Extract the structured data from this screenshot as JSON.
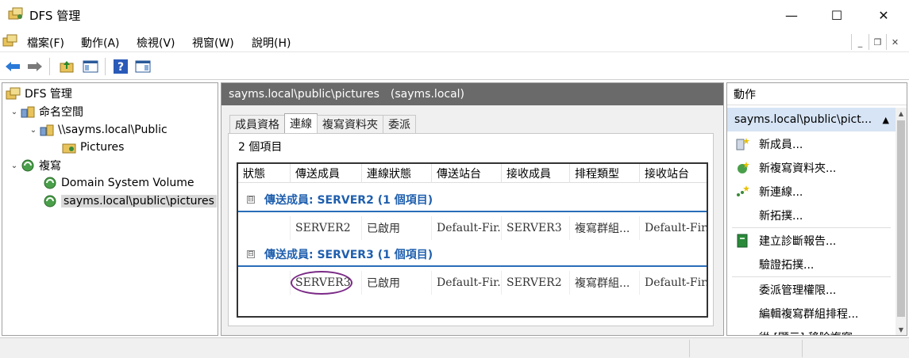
{
  "window": {
    "title": "DFS 管理",
    "minimize_glyph": "—",
    "maximize_glyph": "☐",
    "close_glyph": "✕"
  },
  "menu": {
    "items": [
      "檔案(F)",
      "動作(A)",
      "檢視(V)",
      "視窗(W)",
      "說明(H)"
    ],
    "mdi_minimize": "_",
    "mdi_restore": "❐",
    "mdi_close": "✕"
  },
  "tree": {
    "root": "DFS 管理",
    "namespaces": "命名空間",
    "namespace_item": "\\\\sayms.local\\Public",
    "folder_item": "Pictures",
    "replication": "複寫",
    "repl_item_1": "Domain System Volume",
    "repl_item_2": "sayms.local\\public\\pictures"
  },
  "center": {
    "header_title": "sayms.local\\public\\pictures",
    "header_sub": "(sayms.local)",
    "tabs": [
      "成員資格",
      "連線",
      "複寫資料夾",
      "委派"
    ],
    "active_tab": 1,
    "item_count": "2 個項目",
    "columns": [
      "狀態",
      "傳送成員",
      "連線狀態",
      "傳送站台",
      "接收成員",
      "排程類型",
      "接收站台"
    ],
    "groups": [
      {
        "title": "傳送成員: SERVER2 (1 個項目)",
        "row": [
          "",
          "SERVER2",
          "已啟用",
          "Default-Fir...",
          "SERVER3",
          "複寫群組...",
          "Default-Fir..."
        ]
      },
      {
        "title": "傳送成員: SERVER3 (1 個項目)",
        "row": [
          "",
          "SERVER3",
          "已啟用",
          "Default-Fir...",
          "SERVER2",
          "複寫群組...",
          "Default-Fir..."
        ]
      }
    ],
    "group_toggle": "⊟"
  },
  "actions": {
    "header": "動作",
    "selected": "sayms.local\\public\\pict...",
    "items": [
      "新成員...",
      "新複寫資料夾...",
      "新連線...",
      "新拓撲...",
      "建立診斷報告...",
      "驗證拓撲...",
      "委派管理權限...",
      "編輯複寫群組排程...",
      "從 [顯示] 移除複寫..."
    ]
  },
  "colors": {
    "accent": "#1f5fae",
    "header_gray": "#6a6a6a",
    "selection_blue": "#d6e4f5",
    "annotation_purple": "#7a2a86"
  }
}
